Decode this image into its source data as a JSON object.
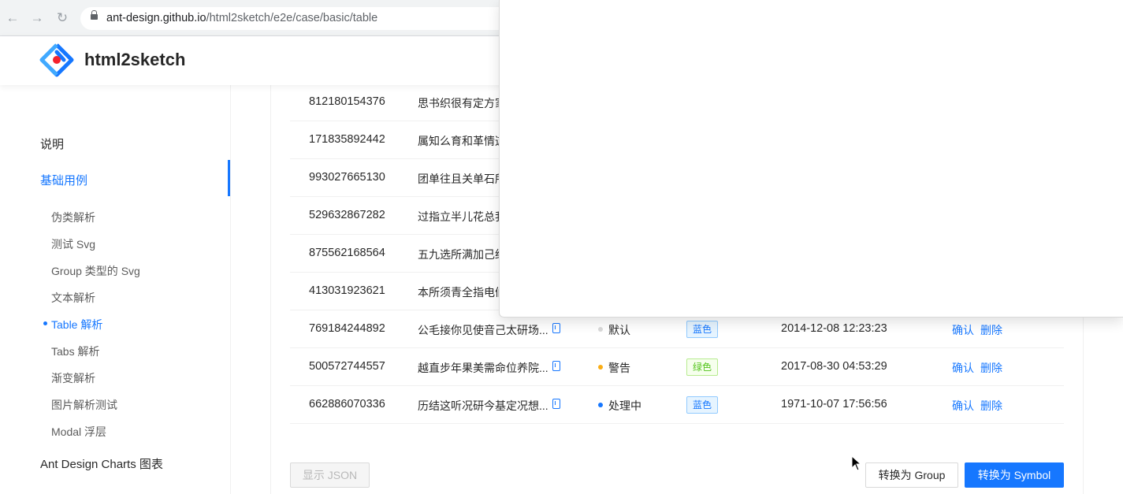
{
  "browser": {
    "url_host": "ant-design.github.io",
    "url_path": "/html2sketch/e2e/case/basic/table"
  },
  "app": {
    "title": "html2sketch",
    "brand_color": "#1677ff"
  },
  "sidebar": {
    "intro": "说明",
    "basic": "基础用例",
    "sub_items": [
      "伪类解析",
      "测试 Svg",
      "Group 类型的 Svg",
      "文本解析",
      "Table 解析",
      "Tabs 解析",
      "渐变解析",
      "图片解析测试",
      "Modal 浮层"
    ],
    "active_sub": "Table 解析",
    "charts": "Ant Design Charts 图表"
  },
  "table": {
    "rows": [
      {
        "id": "812180154376",
        "title": "思书织很有定方家"
      },
      {
        "id": "171835892442",
        "title": "属知么育和革情这"
      },
      {
        "id": "993027665130",
        "title": "团单往且关单石所"
      },
      {
        "id": "529632867282",
        "title": "过指立半儿花总我"
      },
      {
        "id": "875562168564",
        "title": "五九选所满加己红"
      },
      {
        "id": "413031923621",
        "title": "本所须青全指电们"
      },
      {
        "id": "769184244892",
        "title": "公毛接你见使音己太研场...",
        "status": "默认",
        "status_color": "#d9d9d9",
        "tag": "蓝色",
        "tag_type": "blue",
        "time": "2014-12-08 12:23:23",
        "confirm": "确认",
        "delete": "删除"
      },
      {
        "id": "500572744557",
        "title": "越直步年果美需命位养院...",
        "status": "警告",
        "status_color": "#faad14",
        "tag": "绿色",
        "tag_type": "green",
        "time": "2017-08-30 04:53:29",
        "confirm": "确认",
        "delete": "删除"
      },
      {
        "id": "662886070336",
        "title": "历结这听况研今基定况想...",
        "status": "处理中",
        "status_color": "#1677ff",
        "tag": "蓝色",
        "tag_type": "blue",
        "time": "1971-10-07 17:56:56",
        "confirm": "确认",
        "delete": "删除"
      }
    ]
  },
  "buttons": {
    "show_json": "显示 JSON",
    "to_group": "转换为 Group",
    "to_symbol": "转换为 Symbol"
  }
}
